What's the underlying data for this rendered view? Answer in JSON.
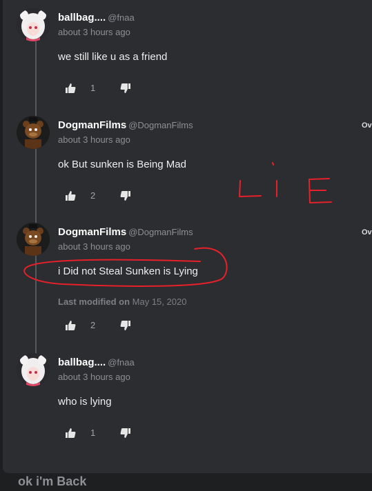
{
  "comments": [
    {
      "username": "ballbag....",
      "handle": "@fnaa",
      "time": "about 3 hours ago",
      "text": "we still like u as a friend",
      "likes": "1",
      "avatar_icon": "anime-girl-avatar"
    },
    {
      "username": "DogmanFilms",
      "handle": "@DogmanFilms",
      "time": "about 3 hours ago",
      "text": "ok But sunken is Being Mad",
      "likes": "2",
      "overflow": "Ov",
      "avatar_icon": "freddy-avatar"
    },
    {
      "username": "DogmanFilms",
      "handle": "@DogmanFilms",
      "time": "about 3 hours ago",
      "text": "i Did not Steal Sunken is Lying",
      "modified_label": "Last modified",
      "modified_on": "on",
      "modified_date": "May 15, 2020",
      "likes": "2",
      "overflow": "Ov",
      "avatar_icon": "freddy-avatar"
    },
    {
      "username": "ballbag....",
      "handle": "@fnaa",
      "time": "about 3 hours ago",
      "text": "who is lying",
      "likes": "1",
      "avatar_icon": "anime-girl-avatar"
    }
  ],
  "bottom_text": "ok i'm Back",
  "annotation": {
    "text": "LIE",
    "color": "#e8202a"
  },
  "colors": {
    "panel": "#2b2d30",
    "background": "#1e1f21",
    "name": "#ffffff",
    "meta": "#8c9096"
  }
}
